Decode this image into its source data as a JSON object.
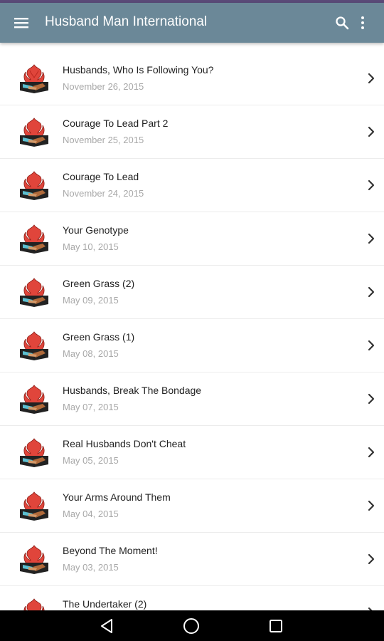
{
  "appbar": {
    "title": "Husband Man International",
    "icons": {
      "menu": "hamburger-menu-icon",
      "search": "search-icon",
      "more": "more-vertical-icon"
    },
    "color": "#6b8898"
  },
  "list": {
    "items": [
      {
        "title": "Husbands, Who Is Following You?",
        "date": "November 26, 2015"
      },
      {
        "title": "Courage To Lead Part 2",
        "date": "November 25, 2015"
      },
      {
        "title": "Courage To Lead",
        "date": "November 24, 2015"
      },
      {
        "title": "Your Genotype",
        "date": "May 10, 2015"
      },
      {
        "title": "Green Grass (2)",
        "date": "May 09, 2015"
      },
      {
        "title": "Green Grass (1)",
        "date": "May 08, 2015"
      },
      {
        "title": "Husbands, Break The Bondage",
        "date": "May 07, 2015"
      },
      {
        "title": "Real Husbands Don't Cheat",
        "date": "May 05, 2015"
      },
      {
        "title": "Your Arms Around Them",
        "date": "May 04, 2015"
      },
      {
        "title": "Beyond The Moment!",
        "date": "May 03, 2015"
      },
      {
        "title": "The Undertaker (2)",
        "date": ""
      }
    ],
    "item_icons": {
      "thumbnail": "flame-handshake-logo-icon",
      "chevron": "chevron-right-icon"
    }
  },
  "system_nav": {
    "icons": {
      "back": "back-triangle-icon",
      "home": "home-circle-icon",
      "recents": "recents-square-icon"
    }
  }
}
